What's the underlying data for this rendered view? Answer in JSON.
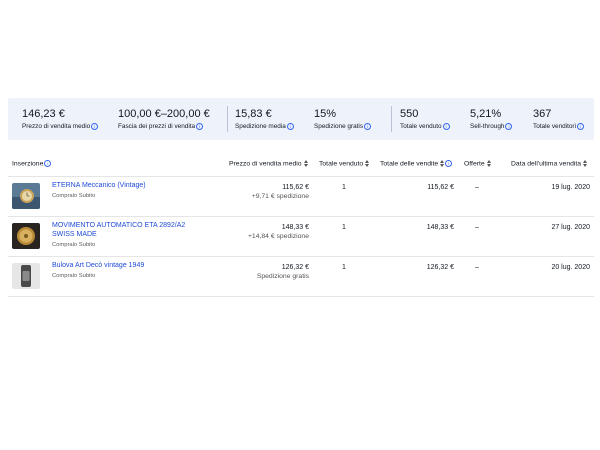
{
  "stats": [
    {
      "value": "146,23 €",
      "label": "Prezzo di vendita medio"
    },
    {
      "value": "100,00 €–200,00 €",
      "label": "Fascia dei prezzi di vendita"
    },
    {
      "value": "15,83 €",
      "label": "Spedizione media"
    },
    {
      "value": "15%",
      "label": "Spedizione gratis"
    },
    {
      "value": "550",
      "label": "Totale venduto"
    },
    {
      "value": "5,21%",
      "label": "Sell-through"
    },
    {
      "value": "367",
      "label": "Totale venditori"
    }
  ],
  "table": {
    "headers": {
      "listing": "Inserzione",
      "avg_price": "Prezzo di vendita medio",
      "total_sold": "Totale venduto",
      "total_sales": "Totale delle vendite",
      "offers": "Offerte",
      "last_sale": "Data dell'ultima vendita"
    },
    "rows": [
      {
        "title": "ETERNA Meccanico (Vintage)",
        "subtitle": "Compralo Subito",
        "price": "115,62 €",
        "shipping": "+9,71 € spedizione",
        "sold": "1",
        "total": "115,62 €",
        "offers": "–",
        "date": "19 lug. 2020"
      },
      {
        "title": "MOVIMENTO AUTOMATICO ETA 2892/A2 SWISS MADE",
        "subtitle": "Compralo Subito",
        "price": "148,33 €",
        "shipping": "+14,84 € spedizione",
        "sold": "1",
        "total": "148,33 €",
        "offers": "–",
        "date": "27 lug. 2020"
      },
      {
        "title": "Bulova Art Decò vintage 1949",
        "subtitle": "Compralo Subito",
        "price": "126,32 €",
        "shipping": "Spedizione gratis",
        "sold": "1",
        "total": "126,32 €",
        "offers": "–",
        "date": "20 lug. 2020"
      }
    ]
  },
  "icons": {
    "info": "info-icon",
    "sort": "sort-icon"
  },
  "colors": {
    "link": "#1f4bd8",
    "stats_bg": "#eef3fb",
    "info": "#3665f3"
  }
}
